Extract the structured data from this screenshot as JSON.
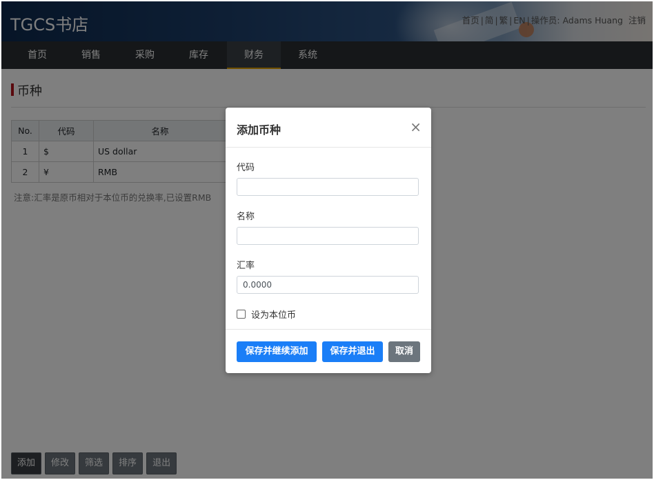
{
  "header": {
    "brand": "TGCS书店",
    "links": {
      "home": "首页",
      "simplified": "简",
      "traditional": "繁",
      "english": "EN",
      "operator_prefix": "操作员:",
      "operator_name": "Adams Huang",
      "logout": "注销",
      "separator": "|"
    }
  },
  "nav": {
    "items": [
      {
        "label": "首页"
      },
      {
        "label": "销售"
      },
      {
        "label": "采购"
      },
      {
        "label": "库存"
      },
      {
        "label": "财务",
        "active": true
      },
      {
        "label": "系统"
      }
    ],
    "active_color": "#e0a100"
  },
  "page": {
    "title": "币种",
    "table": {
      "headers": [
        "No.",
        "代码",
        "名称"
      ],
      "rows": [
        [
          "1",
          "$",
          "US dollar"
        ],
        [
          "2",
          "¥",
          "RMB"
        ]
      ]
    },
    "note": "注意:汇率是原币相对于本位币的兑换率,已设置RMB"
  },
  "bottom_buttons": [
    "添加",
    "修改",
    "筛选",
    "排序",
    "退出"
  ],
  "modal": {
    "title": "添加币种",
    "close_symbol": "×",
    "fields": {
      "code_label": "代码",
      "code_value": "",
      "name_label": "名称",
      "name_value": "",
      "rate_label": "汇率",
      "rate_value": "0.0000"
    },
    "checkbox_label": "设为本位币",
    "checkbox_checked": false,
    "buttons": {
      "save_continue": "保存并继续添加",
      "save_exit": "保存并退出",
      "cancel": "取消"
    },
    "primary_color": "#1a7ef7"
  }
}
